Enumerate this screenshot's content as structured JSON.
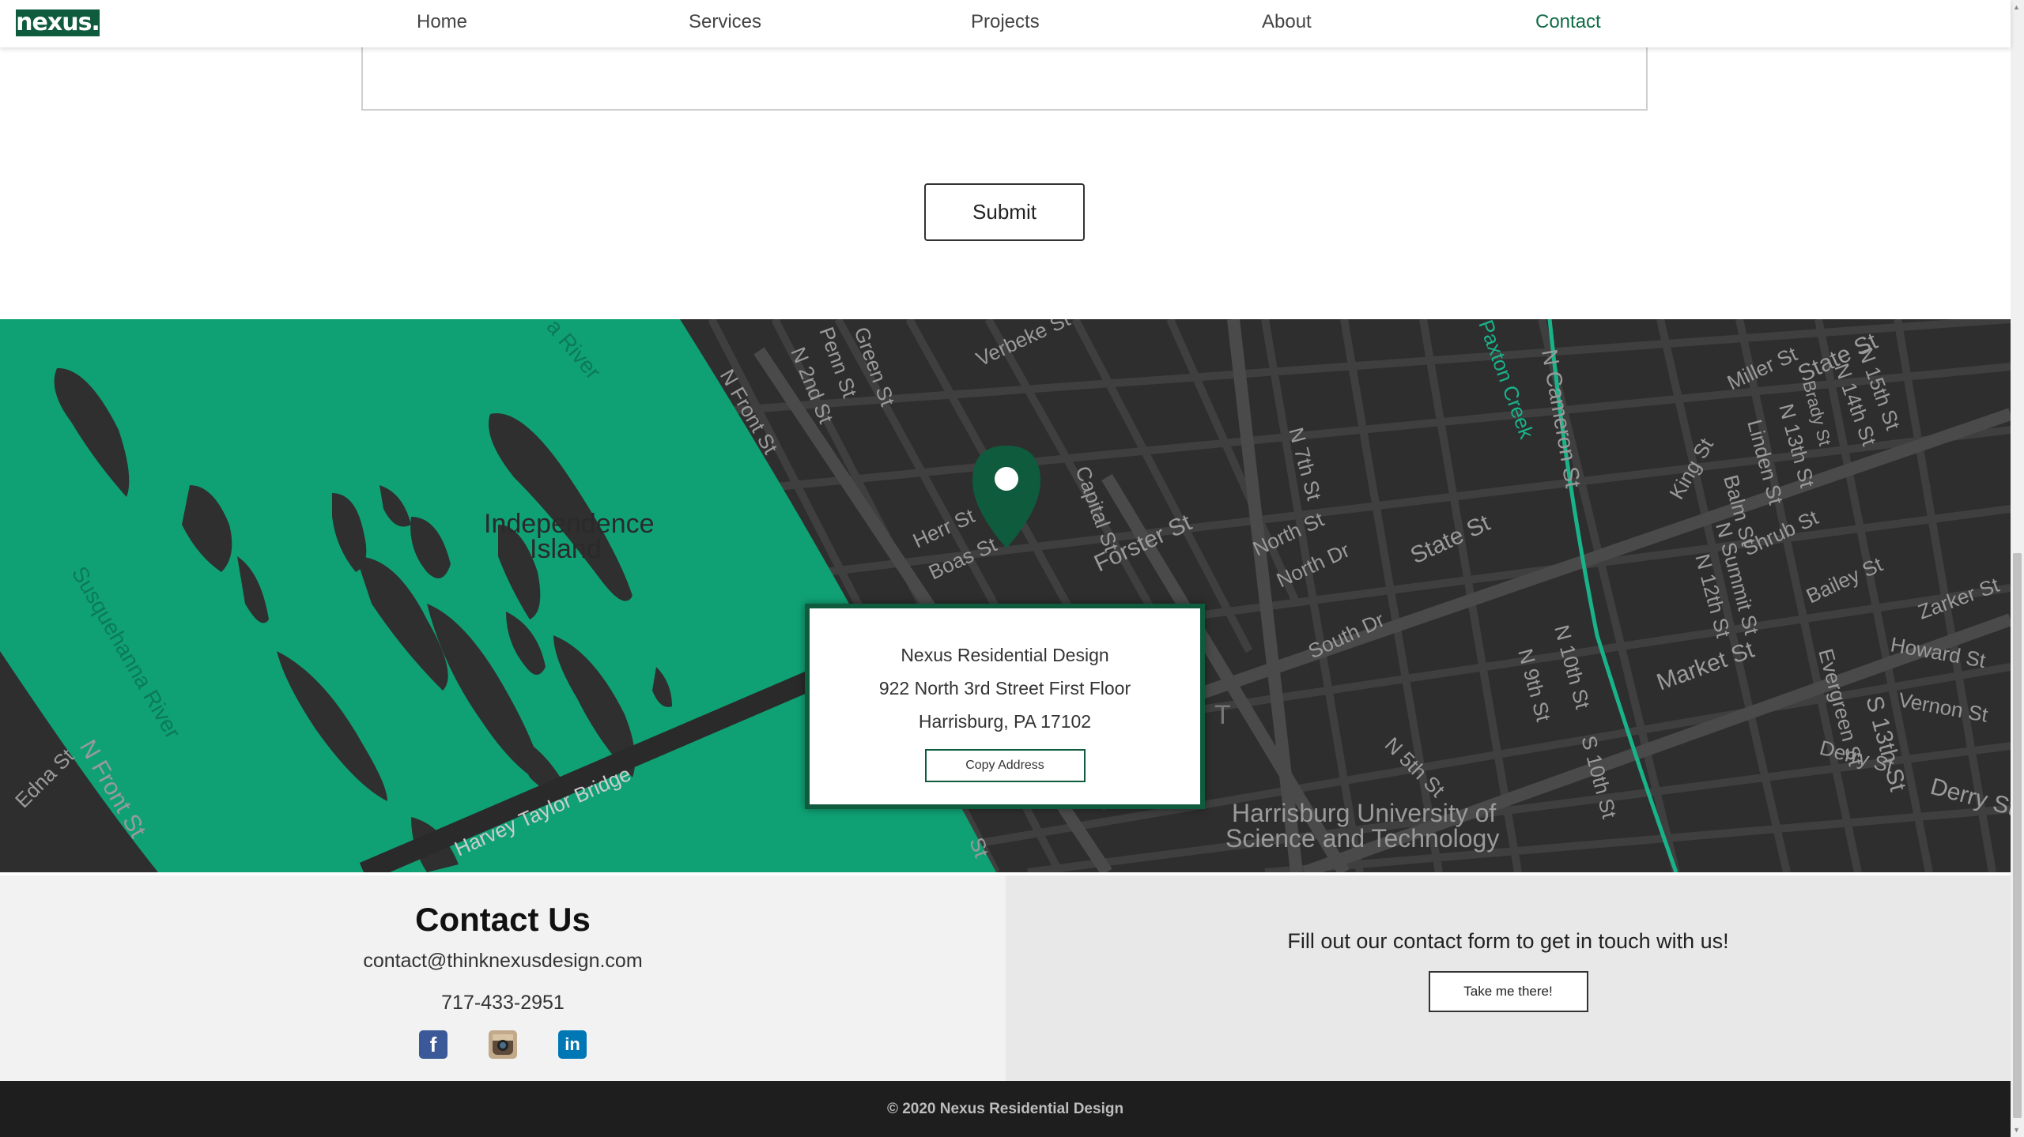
{
  "header": {
    "logo_text": "nexus.",
    "nav": [
      "Home",
      "Services",
      "Projects",
      "About",
      "Contact"
    ],
    "active": "Contact"
  },
  "form": {
    "submit_label": "Submit"
  },
  "map": {
    "labels": {
      "island": [
        "Independence",
        "Island"
      ],
      "river_left": "Susquehanna River",
      "river_top": "a River",
      "bridge": "Harvey Taylor Bridge",
      "university": [
        "Harrisburg University of",
        "Science and Technology"
      ],
      "streets": [
        "N Front St",
        "N 2nd St",
        "Penn St",
        "Green St",
        "Verbeke St",
        "Herr St",
        "Boas St",
        "Capital St",
        "Forster St",
        "N 7th St",
        "North St",
        "North Dr",
        "South Dr",
        "State St",
        "Paxton Creek",
        "N Cameron St",
        "N 9th St",
        "N 10th St",
        "S 10th St",
        "Market St",
        "Miller St",
        "State St",
        "N 15th St",
        "N 14th St",
        "Brady St",
        "N 13th St",
        "Linden St",
        "Balm St",
        "King St",
        "N Summit St",
        "N 12th St",
        "Shrub St",
        "Bailey St",
        "Zarker St",
        "Howard St",
        "Vernon St",
        "Evergreen St",
        "S 13th St",
        "Derry St",
        "Derry St",
        "N 5th St",
        "Edna St",
        "N Front St",
        "T",
        "St"
      ]
    },
    "colors": {
      "water": "#0fa174",
      "land": "#2e2e2e",
      "island": "#2f2f2f",
      "pin": "#0f5b3e",
      "creek": "#19b38a"
    }
  },
  "address_card": {
    "name": "Nexus Residential Design",
    "street": "922 North 3rd Street First Floor",
    "city": "Harrisburg, PA 17102",
    "copy_label": "Copy Address"
  },
  "contact": {
    "title": "Contact Us",
    "email": "contact@thinknexusdesign.com",
    "phone": "717-433-2951",
    "socials": [
      "facebook-icon",
      "instagram-icon",
      "linkedin-icon"
    ],
    "cta_text": "Fill out our contact form to get in touch with us!",
    "cta_button": "Take me there!"
  },
  "footer": {
    "copyright": "© 2020 Nexus Residential Design"
  }
}
